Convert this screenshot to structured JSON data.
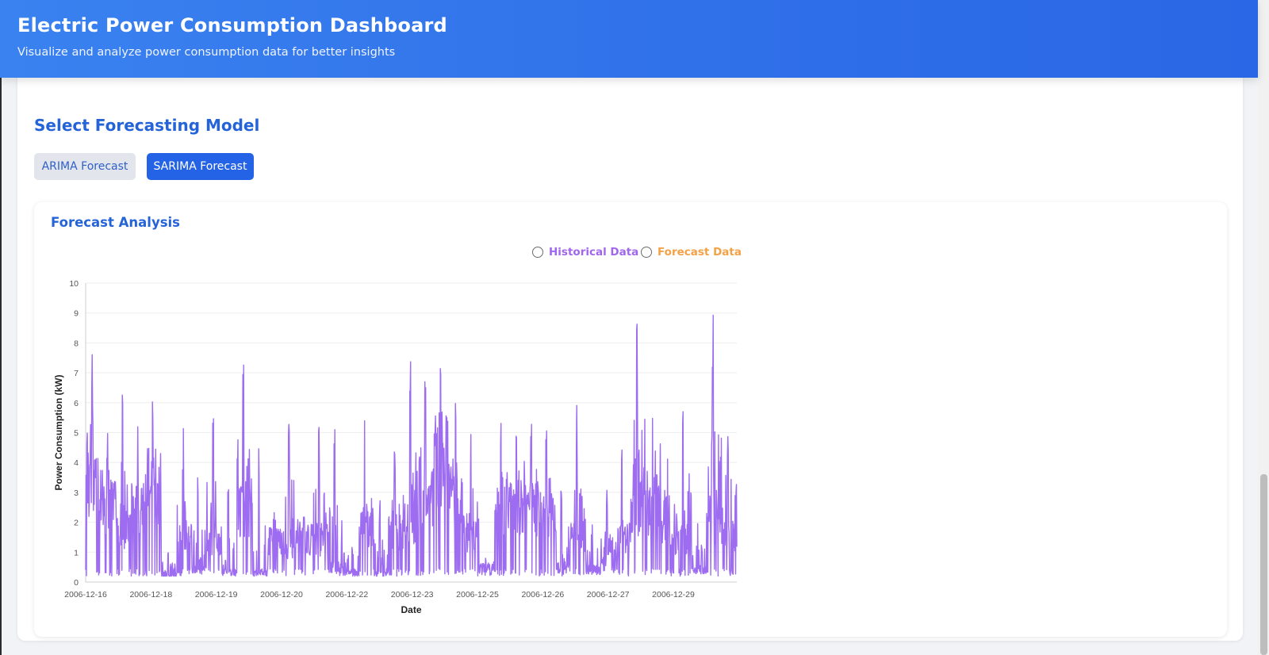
{
  "header": {
    "title": "Electric Power Consumption Dashboard",
    "subtitle": "Visualize and analyze power consumption data for better insights"
  },
  "model_section": {
    "title": "Select Forecasting Model",
    "buttons": [
      {
        "label": "ARIMA Forecast",
        "active": false
      },
      {
        "label": "SARIMA Forecast",
        "active": true
      }
    ]
  },
  "chart_panel": {
    "title": "Forecast Analysis",
    "legend": [
      {
        "label": "Historical Data",
        "color": "#a066ee"
      },
      {
        "label": "Forecast Data",
        "color": "#f4a145"
      }
    ]
  },
  "colors": {
    "accent": "#2563e6",
    "historical_series": "#9d6cf0",
    "forecast_series": "#f4a145"
  },
  "chart_data": {
    "type": "line",
    "xlabel": "Date",
    "ylabel": "Power Consumption (kW)",
    "ylim": [
      0,
      10
    ],
    "yticks": [
      0,
      1,
      2,
      3,
      4,
      5,
      6,
      7,
      8,
      9,
      10
    ],
    "xtick_labels": [
      "2006-12-16",
      "2006-12-18",
      "2006-12-19",
      "2006-12-20",
      "2006-12-22",
      "2006-12-23",
      "2006-12-25",
      "2006-12-26",
      "2006-12-27",
      "2006-12-29"
    ],
    "grid": true,
    "legend_position": "top-right",
    "series": [
      {
        "name": "Historical Data",
        "peaks": [
          7.7,
          5.3,
          7.1,
          5.9,
          6.3,
          1.4,
          5.2,
          3.6,
          6.2,
          4.7,
          7.8,
          4.8,
          2.4,
          6.0,
          2.2,
          5.4,
          5.2,
          2.4,
          6.0,
          2.9,
          5.0,
          7.9,
          7.3,
          8.7,
          6.2,
          5.2,
          0.8,
          5.5,
          6.5,
          6.0,
          5.2,
          3.5,
          6.0,
          2.5,
          3.4,
          5.0,
          9.1,
          7.3,
          5.5,
          6.9,
          2.3,
          9.1,
          6.3
        ],
        "baseline": [
          3.5,
          2.5,
          1.8,
          2.5,
          3.0,
          0.2,
          1.5,
          0.4,
          1.5,
          0.3,
          2.5,
          0.3,
          1.5,
          1.3,
          1.5,
          1.4,
          0.5,
          0.3,
          1.8,
          0.3,
          1.5,
          2.0,
          3.0,
          4.0,
          2.5,
          1.5,
          0.5,
          2.5,
          2.5,
          2.4,
          2.2,
          0.5,
          1.5,
          0.4,
          0.8,
          1.5,
          2.5,
          2.6,
          1.5,
          1.5,
          0.4,
          2.0,
          1.5
        ],
        "min_value": 0.2
      },
      {
        "name": "Forecast Data",
        "values": []
      }
    ]
  }
}
